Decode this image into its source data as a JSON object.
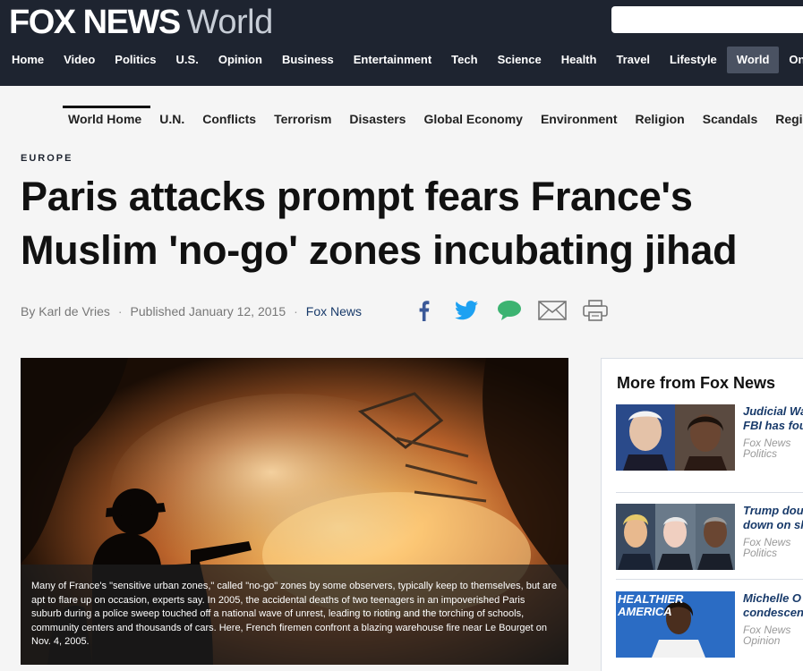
{
  "header": {
    "logo_brand": "FOX NEWS",
    "logo_section": "World"
  },
  "main_nav": [
    "Home",
    "Video",
    "Politics",
    "U.S.",
    "Opinion",
    "Business",
    "Entertainment",
    "Tech",
    "Science",
    "Health",
    "Travel",
    "Lifestyle",
    "World",
    "On Air"
  ],
  "main_nav_active": "World",
  "sub_nav": [
    "World Home",
    "U.N.",
    "Conflicts",
    "Terrorism",
    "Disasters",
    "Global Economy",
    "Environment",
    "Religion",
    "Scandals",
    "Regions"
  ],
  "sub_nav_active": "World Home",
  "article": {
    "kicker": "EUROPE",
    "headline": "Paris attacks prompt fears France's Muslim 'no-go' zones incubating jihad",
    "byline_author": "By Karl de Vries",
    "byline_published": "Published January 12, 2015",
    "byline_source": "Fox News",
    "caption": "Many of France's \"sensitive urban zones,\" called \"no-go\" zones by some observers, typically keep to themselves, but are apt to flare up on occasion, experts say. In 2005, the accidental deaths of two teenagers in an impoverished Paris suburb during a police sweep touched off a national wave of unrest, leading to rioting and the torching of schools, community centers and thousands of cars. Here, French firemen confront a blazing warehouse fire near Le Bourget on Nov. 4, 2005."
  },
  "share_icons": [
    "facebook-icon",
    "twitter-icon",
    "comment-icon",
    "email-icon",
    "print-icon"
  ],
  "sidebar": {
    "title": "More from Fox News",
    "stories": [
      {
        "title_line1": "Judicial Wa",
        "title_line2": "FBI has fou",
        "tag_line1": "Fox News",
        "tag_line2": "Politics"
      },
      {
        "title_line1": "Trump dou",
        "title_line2": "down on sl",
        "tag_line1": "Fox News",
        "tag_line2": "Politics"
      },
      {
        "title_line1": "Michelle O",
        "title_line2": "condescen",
        "tag_line1": "Fox News",
        "tag_line2": "Opinion"
      }
    ]
  },
  "thumb_text": {
    "story3": "HEALTHIER AMERICA"
  },
  "colors": {
    "header_bg": "#1e2430",
    "link_blue": "#183a6a",
    "facebook": "#3b5998",
    "twitter": "#1da1f2",
    "comment": "#3cb371"
  }
}
